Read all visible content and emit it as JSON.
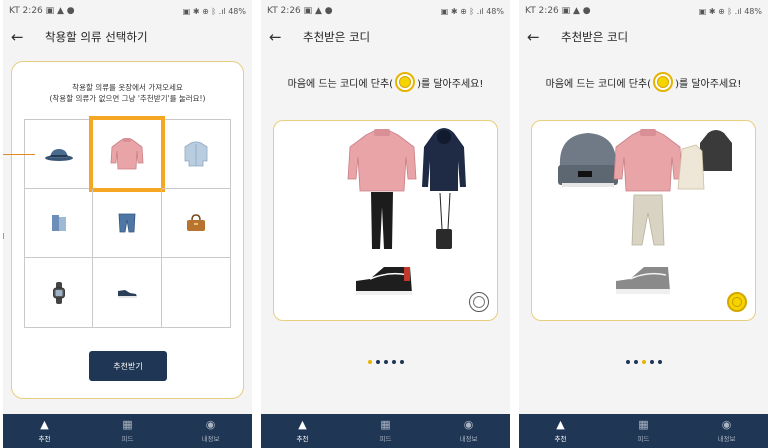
{
  "status_left": [
    "KT 2:26 ▣ ▲ ●",
    "KT 2:26 ▣ ▲ ●",
    "KT 2:26 ▣ ▲ ●"
  ],
  "status_right": "▣ ✱ ⊕ ᛒ .ıl 48%",
  "screen1": {
    "title": "착용할 의류 선택하기",
    "instr_line1": "착용할 의류를 옷장에서 가져오세요",
    "instr_line2": "(착용할 의류가 없으면 그냥 '추천받기'를 눌러요!)",
    "recommend_label": "추천받기",
    "grid_icons": [
      "hat-icon",
      "sweater-icon",
      "shirt-icon",
      "vest-icon",
      "jeans-icon",
      "handbag-icon",
      "watch-icon",
      "sneaker-icon",
      "empty-slot"
    ],
    "selected_index": 1
  },
  "screen2": {
    "title": "추천받은 코디",
    "msg_before": "마음에 드는 코디에 단추(",
    "msg_after": ")를 달아주세요!",
    "liked": false,
    "active_dot": 0
  },
  "screen3": {
    "title": "추천받은 코디",
    "msg_before": "마음에 드는 코디에 단추(",
    "msg_after": ")를 달아주세요!",
    "liked": true,
    "active_dot": 2
  },
  "nav": {
    "items": [
      {
        "label": "추천",
        "icon": "shirt-nav-icon"
      },
      {
        "label": "피드",
        "icon": "book-nav-icon"
      },
      {
        "label": "내정보",
        "icon": "profile-nav-icon"
      }
    ]
  },
  "colors": {
    "navy": "#1f3654",
    "gold_border": "#e6cf7f",
    "highlight_orange": "#f5a623",
    "button_yellow": "#f6d400"
  }
}
